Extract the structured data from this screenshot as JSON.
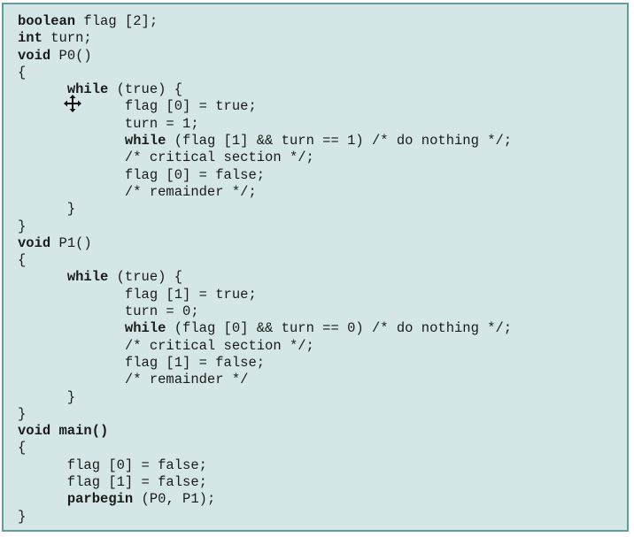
{
  "code": {
    "lines": [
      [
        {
          "t": "boolean",
          "k": true
        },
        {
          "t": " flag [2];"
        }
      ],
      [
        {
          "t": "int",
          "k": true
        },
        {
          "t": " turn;"
        }
      ],
      [
        {
          "t": "void",
          "k": true
        },
        {
          "t": " P0()"
        }
      ],
      [
        {
          "t": "{"
        }
      ],
      [
        {
          "t": "      "
        },
        {
          "t": "while",
          "k": true
        },
        {
          "t": " (true) {"
        }
      ],
      [
        {
          "t": "             flag [0] = true;"
        }
      ],
      [
        {
          "t": "             turn = 1;"
        }
      ],
      [
        {
          "t": "             "
        },
        {
          "t": "while",
          "k": true
        },
        {
          "t": " (flag [1] && turn == 1) /* do nothing */;"
        }
      ],
      [
        {
          "t": "             /* critical section */;"
        }
      ],
      [
        {
          "t": "             flag [0] = false;"
        }
      ],
      [
        {
          "t": "             /* remainder */;"
        }
      ],
      [
        {
          "t": "      }"
        }
      ],
      [
        {
          "t": "}"
        }
      ],
      [
        {
          "t": "void",
          "k": true
        },
        {
          "t": " P1()"
        }
      ],
      [
        {
          "t": "{"
        }
      ],
      [
        {
          "t": "      "
        },
        {
          "t": "while",
          "k": true
        },
        {
          "t": " (true) {"
        }
      ],
      [
        {
          "t": "             flag [1] = true;"
        }
      ],
      [
        {
          "t": "             turn = 0;"
        }
      ],
      [
        {
          "t": "             "
        },
        {
          "t": "while",
          "k": true
        },
        {
          "t": " (flag [0] && turn == 0) /* do nothing */;"
        }
      ],
      [
        {
          "t": "             /* critical section */;"
        }
      ],
      [
        {
          "t": "             flag [1] = false;"
        }
      ],
      [
        {
          "t": "             /* remainder */"
        }
      ],
      [
        {
          "t": "      }"
        }
      ],
      [
        {
          "t": "}"
        }
      ],
      [
        {
          "t": "void main()",
          "k": true
        }
      ],
      [
        {
          "t": "{"
        }
      ],
      [
        {
          "t": "      flag [0] = false;"
        }
      ],
      [
        {
          "t": "      flag [1] = false;"
        }
      ],
      [
        {
          "t": "      "
        },
        {
          "t": "parbegin",
          "k": true
        },
        {
          "t": " (P0, P1);"
        }
      ],
      [
        {
          "t": "}"
        }
      ]
    ]
  },
  "overlay": {
    "cursor_icon": "move-cursor-icon"
  },
  "colors": {
    "background": "#d4e6e6",
    "border": "#5f9ea0",
    "text": "#1a1a1a"
  }
}
